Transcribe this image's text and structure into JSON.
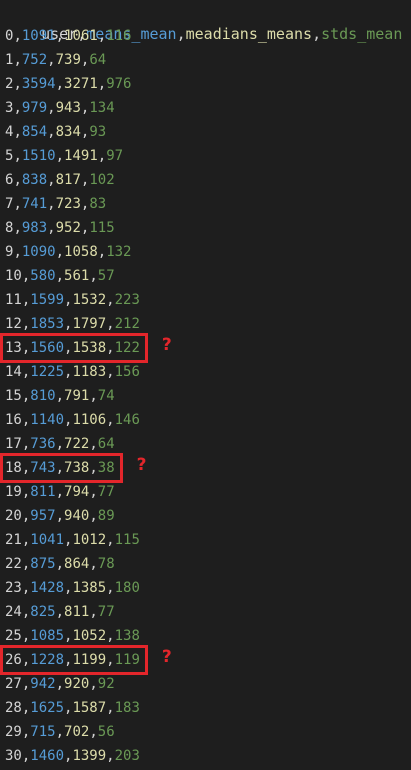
{
  "header": {
    "columns": [
      "user",
      "means_mean",
      "meadians_means",
      "stds_mean"
    ]
  },
  "rows": [
    [
      "0",
      "1091",
      "1061",
      "116"
    ],
    [
      "1",
      "752",
      "739",
      "64"
    ],
    [
      "2",
      "3594",
      "3271",
      "976"
    ],
    [
      "3",
      "979",
      "943",
      "134"
    ],
    [
      "4",
      "854",
      "834",
      "93"
    ],
    [
      "5",
      "1510",
      "1491",
      "97"
    ],
    [
      "6",
      "838",
      "817",
      "102"
    ],
    [
      "7",
      "741",
      "723",
      "83"
    ],
    [
      "8",
      "983",
      "952",
      "115"
    ],
    [
      "9",
      "1090",
      "1058",
      "132"
    ],
    [
      "10",
      "580",
      "561",
      "57"
    ],
    [
      "11",
      "1599",
      "1532",
      "223"
    ],
    [
      "12",
      "1853",
      "1797",
      "212"
    ],
    [
      "13",
      "1560",
      "1538",
      "122"
    ],
    [
      "14",
      "1225",
      "1183",
      "156"
    ],
    [
      "15",
      "810",
      "791",
      "74"
    ],
    [
      "16",
      "1140",
      "1106",
      "146"
    ],
    [
      "17",
      "736",
      "722",
      "64"
    ],
    [
      "18",
      "743",
      "738",
      "38"
    ],
    [
      "19",
      "811",
      "794",
      "77"
    ],
    [
      "20",
      "957",
      "940",
      "89"
    ],
    [
      "21",
      "1041",
      "1012",
      "115"
    ],
    [
      "22",
      "875",
      "864",
      "78"
    ],
    [
      "23",
      "1428",
      "1385",
      "180"
    ],
    [
      "24",
      "825",
      "811",
      "77"
    ],
    [
      "25",
      "1085",
      "1052",
      "138"
    ],
    [
      "26",
      "1228",
      "1199",
      "119"
    ],
    [
      "27",
      "942",
      "920",
      "92"
    ],
    [
      "28",
      "1625",
      "1587",
      "183"
    ],
    [
      "29",
      "715",
      "702",
      "56"
    ],
    [
      "30",
      "1460",
      "1399",
      "203"
    ]
  ],
  "annotations": [
    {
      "row_index": 13,
      "mark": "?"
    },
    {
      "row_index": 18,
      "mark": "?"
    },
    {
      "row_index": 26,
      "mark": "?"
    }
  ],
  "colors": {
    "background": "#1e1e1e",
    "col_user": "#d4d4d4",
    "col_means_mean": "#569cd6",
    "col_meadians_means": "#dcdcaa",
    "col_stds_mean": "#6a9955",
    "annotation": "#e3262b"
  }
}
